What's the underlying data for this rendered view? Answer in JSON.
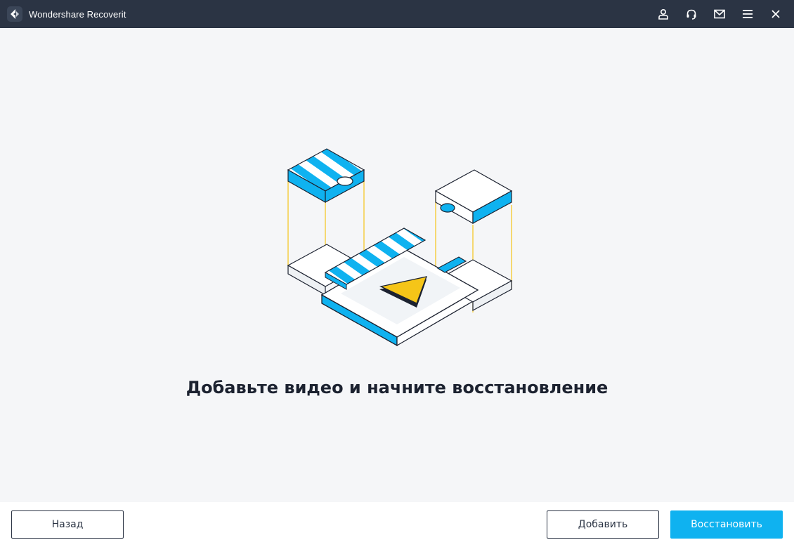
{
  "window": {
    "title": "Wondershare Recoverit",
    "titlebar_color": "#2b3444",
    "icons": [
      "account-icon",
      "support-headset-icon",
      "mail-icon",
      "menu-icon",
      "close-icon"
    ]
  },
  "main": {
    "headline": "Добавьте видео и начните восстановление",
    "accent_blue": "#0fb2f0",
    "accent_yellow": "#f5c518"
  },
  "footer": {
    "back_label": "Назад",
    "add_label": "Добавить",
    "restore_label": "Восстановить"
  }
}
